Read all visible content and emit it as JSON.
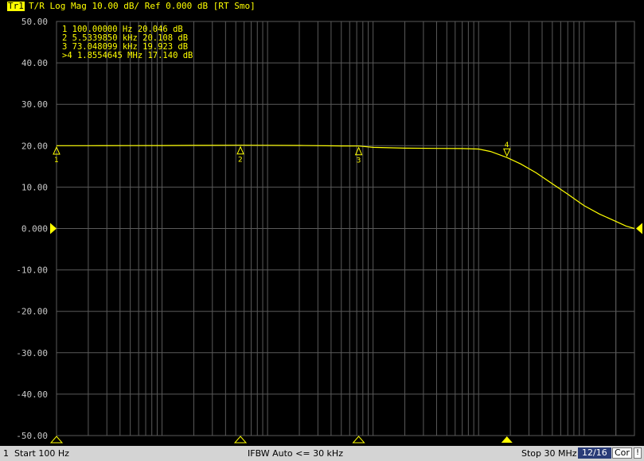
{
  "trace": {
    "tag": "Tr1",
    "info": "T/R Log Mag 10.00 dB/ Ref 0.000 dB [RT Smo]"
  },
  "colors": {
    "background": "#000000",
    "grid": "#5a5a5a",
    "trace": "#ffff00",
    "label": "#c8c8c8",
    "status_bar": "#d4d4d4",
    "badge": "#2a3c78"
  },
  "chart_data": {
    "type": "line",
    "title": "",
    "xlabel": "",
    "ylabel": "",
    "x_scale": "log",
    "xlim": [
      100,
      30000000
    ],
    "ylim": [
      -50,
      50
    ],
    "grid": true,
    "y_ticks": [
      {
        "value": 50,
        "label": "50.00"
      },
      {
        "value": 40,
        "label": "40.00"
      },
      {
        "value": 30,
        "label": "30.00"
      },
      {
        "value": 20,
        "label": "20.00"
      },
      {
        "value": 10,
        "label": "10.00"
      },
      {
        "value": 0,
        "label": "0.000"
      },
      {
        "value": -10,
        "label": "-10.00"
      },
      {
        "value": -20,
        "label": "-20.00"
      },
      {
        "value": -30,
        "label": "-30.00"
      },
      {
        "value": -40,
        "label": "-40.00"
      },
      {
        "value": -50,
        "label": "-50.00"
      }
    ],
    "series": [
      {
        "x": [
          100,
          200,
          500,
          1000,
          2000,
          5533.985,
          10000,
          20000,
          50000,
          73048.099,
          100000,
          200000,
          400000,
          700000,
          1000000,
          1300000,
          1855464.5,
          2500000,
          3500000,
          5000000,
          7000000,
          10000000,
          14000000,
          20000000,
          25000000,
          30000000
        ],
        "values": [
          20.0,
          20.0,
          20.02,
          20.04,
          20.07,
          20.108,
          20.1,
          20.05,
          19.95,
          19.923,
          19.6,
          19.4,
          19.35,
          19.3,
          19.2,
          18.6,
          17.14,
          15.6,
          13.5,
          10.8,
          8.3,
          5.5,
          3.5,
          1.7,
          0.6,
          0.0
        ]
      }
    ],
    "markers": [
      {
        "id": "1",
        "freq": 100,
        "value": 20.046,
        "label": "1   100.00000  Hz    20.046  dB",
        "active": false
      },
      {
        "id": "2",
        "freq": 5533.985,
        "value": 20.108,
        "label": "2   5.5339850  kHz   20.108  dB",
        "active": false
      },
      {
        "id": "3",
        "freq": 73048.099,
        "value": 19.923,
        "label": "3   73.048099  kHz   19.923  dB",
        "active": false
      },
      {
        "id": "4",
        "freq": 1855464.5,
        "value": 17.14,
        "label": ">4  1.8554645  MHz   17.140  dB",
        "active": true
      }
    ],
    "reference_value": 0
  },
  "status": {
    "start": "1  Start 100 Hz",
    "ifbw": "IFBW Auto <= 30 kHz",
    "stop": "Stop 30 MHz",
    "channel_page": "12/16",
    "cor": "Cor",
    "more": "!"
  }
}
